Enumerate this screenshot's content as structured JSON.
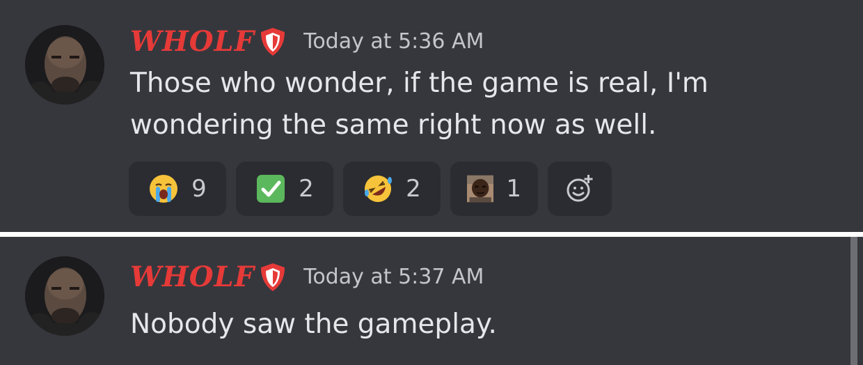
{
  "messages": [
    {
      "username": "WHOLF",
      "timestamp": "Today at 5:36 AM",
      "text_line1": "Those who wonder, if the game is real, I'm",
      "text_line2": "wondering the same right now as well.",
      "reactions": [
        {
          "emoji": "loudly-crying-face",
          "count": "9"
        },
        {
          "emoji": "check-mark-button",
          "count": "2"
        },
        {
          "emoji": "rolling-on-floor-laughing",
          "count": "2"
        },
        {
          "emoji": "custom-face-emoji",
          "count": "1"
        }
      ]
    },
    {
      "username": "WHOLF",
      "timestamp": "Today at 5:37 AM",
      "text_line1": "Nobody saw the gameplay."
    }
  ],
  "colors": {
    "background": "#36373d",
    "username": "#e63a38",
    "text": "#e6e7ea",
    "timestamp": "#c5c6cb",
    "reaction_bg": "#2b2c31"
  },
  "icons": [
    "avatar",
    "shield-badge-icon",
    "add-reaction-icon"
  ]
}
